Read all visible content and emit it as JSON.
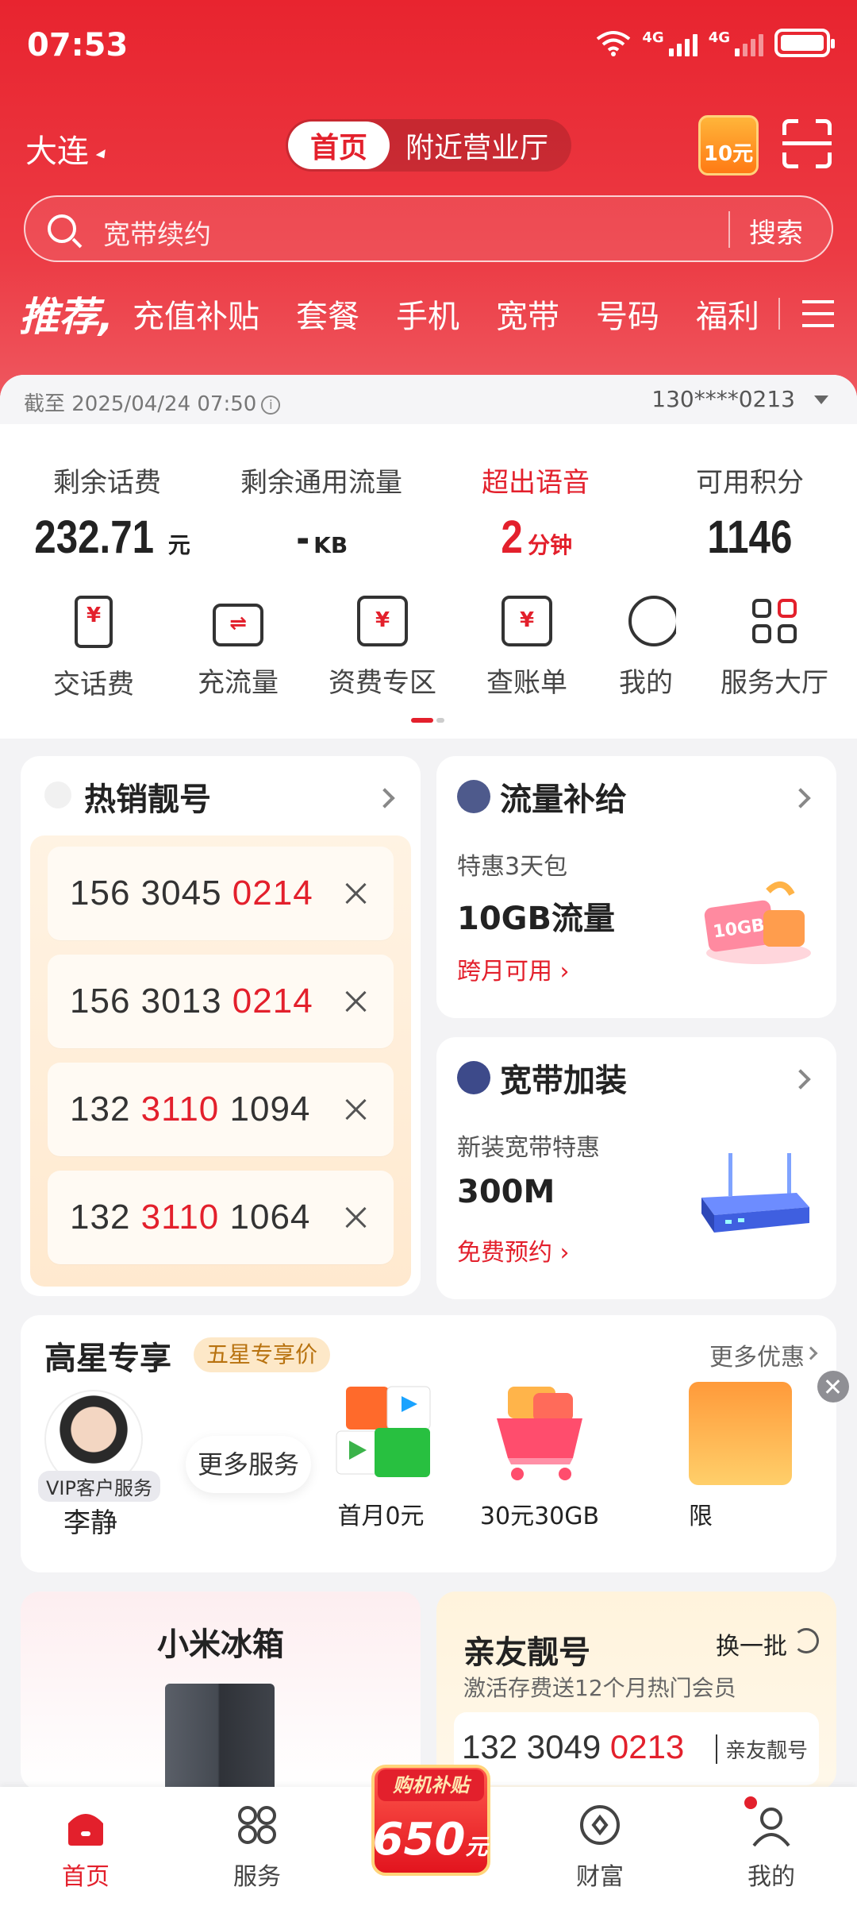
{
  "status_bar": {
    "time": "07:53",
    "network_1": "4G",
    "network_2": "4G"
  },
  "header": {
    "city": "大连",
    "segments": [
      "首页",
      "附近营业厅"
    ],
    "coupon_label": "10元",
    "search_placeholder": "宽带续约",
    "search_button": "搜索"
  },
  "categories": {
    "recommend": "推荐,",
    "items": [
      "充值补贴",
      "套餐",
      "手机",
      "宽带",
      "号码",
      "福利"
    ]
  },
  "account": {
    "as_of": "截至 2025/04/24 07:50",
    "phone": "130****0213",
    "stats": [
      {
        "label": "剩余话费",
        "value": "232.71",
        "unit": "元"
      },
      {
        "label": "剩余通用流量",
        "value": "-",
        "unit": "KB"
      },
      {
        "label": "超出语音",
        "value": "2",
        "unit": "分钟"
      },
      {
        "label": "可用积分",
        "value": "1146",
        "unit": ""
      }
    ],
    "quick_actions": [
      "交话费",
      "充流量",
      "资费专区",
      "查账单",
      "我的",
      "服务大厅"
    ]
  },
  "hot_numbers": {
    "title": "热销靓号",
    "rows": [
      {
        "a": "156",
        "b": "3045",
        "c": "0214",
        "red": "c"
      },
      {
        "a": "156",
        "b": "3013",
        "c": "0214",
        "red": "c"
      },
      {
        "a": "132",
        "b": "3110",
        "c": "1094",
        "red": "b"
      },
      {
        "a": "132",
        "b": "3110",
        "c": "1064",
        "red": "b"
      }
    ]
  },
  "flow": {
    "title": "流量补给",
    "sub": "特惠3天包",
    "big": "10GB流量",
    "link": "跨月可用",
    "gift_text": "10GB"
  },
  "broadband": {
    "title": "宽带加装",
    "sub": "新装宽带特惠",
    "big": "300M",
    "link": "免费预约"
  },
  "vip": {
    "title": "高星专享",
    "tag": "五星专享价",
    "more": "更多优惠",
    "badge": "VIP客户服务",
    "agent": "李静",
    "more_service": "更多服务",
    "products": [
      "首月0元",
      "30元30GB",
      "限"
    ]
  },
  "fridge": {
    "title": "小米冰箱"
  },
  "family": {
    "title": "亲友靓号",
    "sub": "激活存费送12个月热门会员",
    "swap": "换一批",
    "num_a": "132",
    "num_b": "3049",
    "num_c": "0213",
    "tag": "亲友靓号"
  },
  "tabbar": {
    "items": [
      "首页",
      "服务",
      "财富",
      "我的"
    ],
    "promo_tag": "购机补贴",
    "promo_amount": "650",
    "promo_unit": "元"
  },
  "colors": {
    "brand_red": "#e3202c",
    "background": "#f3f3f5"
  }
}
